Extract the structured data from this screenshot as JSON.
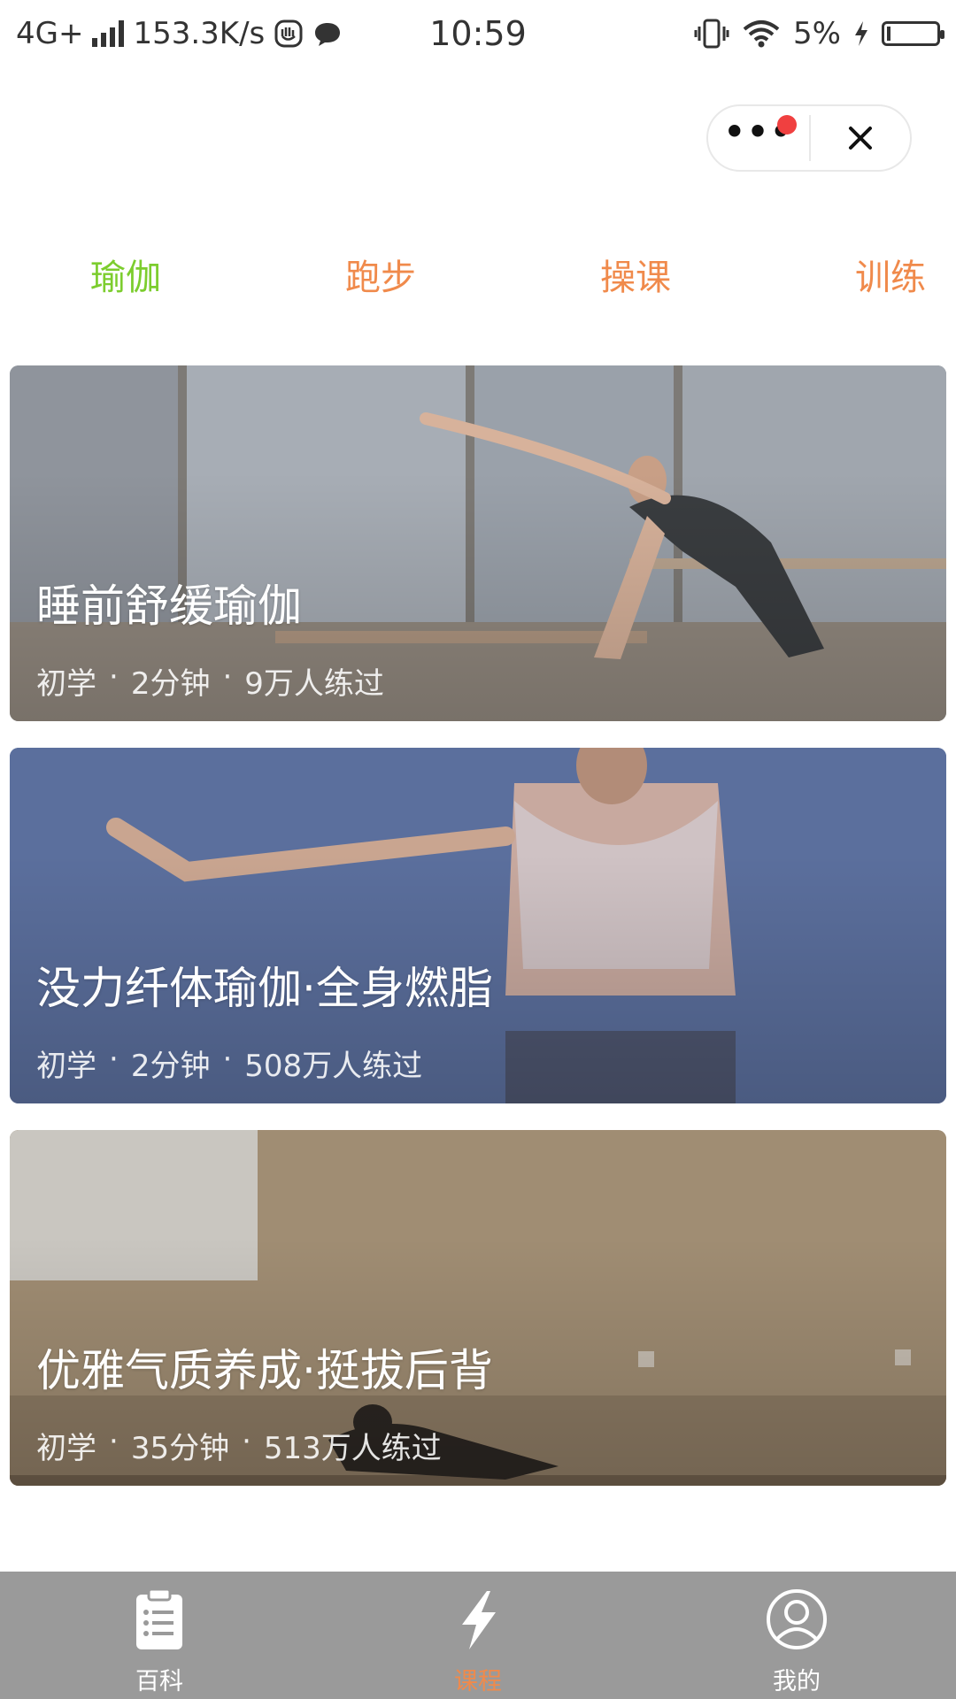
{
  "status_bar": {
    "network": "4G+",
    "speed": "153.3K/s",
    "time": "10:59",
    "battery": "5%"
  },
  "capsule": {
    "more_icon": "more-dots-icon",
    "close_icon": "close-icon",
    "badge_color": "#f04040"
  },
  "tabs": [
    {
      "label": "瑜伽",
      "active": true
    },
    {
      "label": "跑步",
      "active": false
    },
    {
      "label": "操课",
      "active": false
    },
    {
      "label": "训练",
      "active": false
    }
  ],
  "colors": {
    "active_tab": "#7ccd2e",
    "inactive_tab": "#f08a4b",
    "nav_background": "#9a9a9a",
    "nav_active": "#f08a4b"
  },
  "courses": [
    {
      "title": "睡前舒缓瑜伽",
      "level": "初学",
      "duration": "2分钟",
      "participants": "9万人练过"
    },
    {
      "title": "没力纤体瑜伽·全身燃脂",
      "level": "初学",
      "duration": "2分钟",
      "participants": "508万人练过"
    },
    {
      "title": "优雅气质养成·挺拔后背",
      "level": "初学",
      "duration": "35分钟",
      "participants": "513万人练过"
    }
  ],
  "bottom_nav": [
    {
      "label": "百科",
      "icon": "clipboard-icon",
      "active": false
    },
    {
      "label": "课程",
      "icon": "lightning-icon",
      "active": true
    },
    {
      "label": "我的",
      "icon": "user-icon",
      "active": false
    }
  ]
}
